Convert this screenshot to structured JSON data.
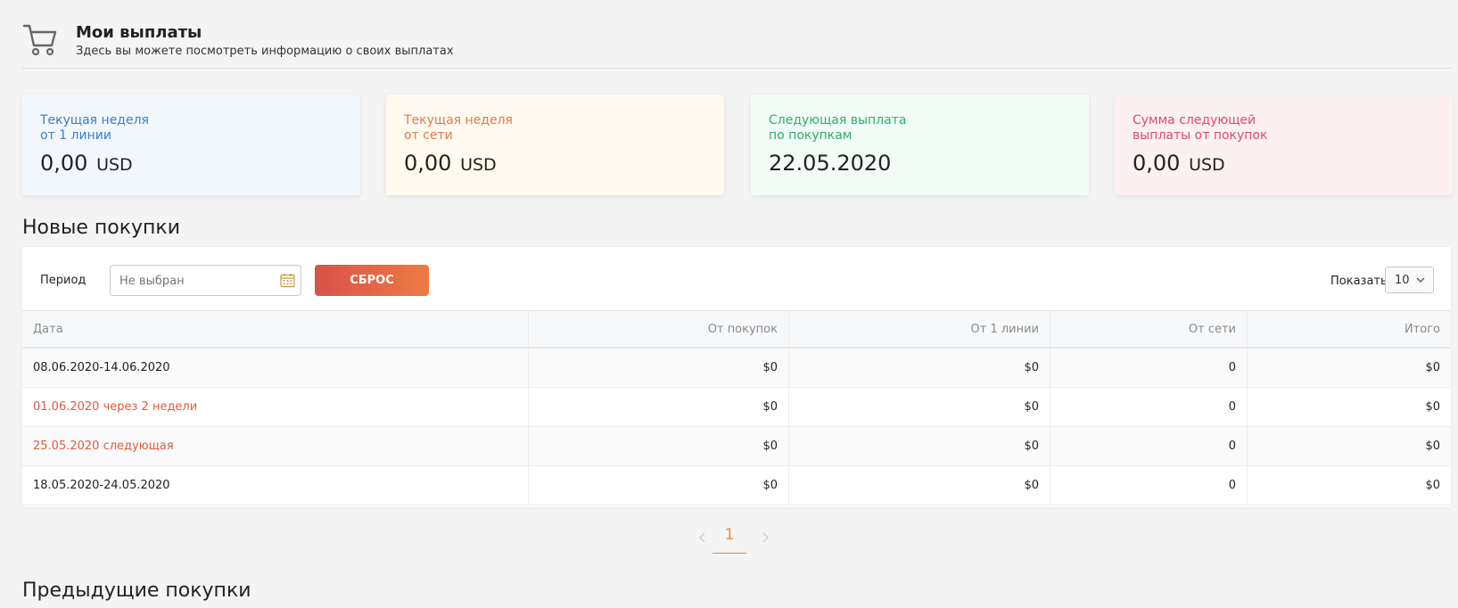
{
  "header": {
    "title": "Мои выплаты",
    "subtitle": "Здесь вы можете посмотреть информацию о своих выплатах",
    "icon": "cart-icon"
  },
  "cards": [
    {
      "label": "Текущая неделя\nот 1 линии",
      "value": "0,00",
      "unit": "USD",
      "color": "#3b7bc4"
    },
    {
      "label": "Текущая неделя\nот сети",
      "value": "0,00",
      "unit": "USD",
      "color": "#de7a4c"
    },
    {
      "label": "Следующая выплата\nпо покупкам",
      "value": "22.05.2020",
      "unit": "",
      "color": "#2fae6b"
    },
    {
      "label": "Сумма следующей\nвыплаты от покупок",
      "value": "0,00",
      "unit": "USD",
      "color": "#d84d6c"
    }
  ],
  "new_purchases": {
    "title": "Новые покупки",
    "filter": {
      "period_label": "Период",
      "period_placeholder": "Не выбран",
      "reset_label": "СБРОС",
      "show_label": "Показать",
      "show_value": "10"
    },
    "table": {
      "headers": [
        "Дата",
        "От покупок",
        "От 1 линии",
        "От сети",
        "Итого"
      ],
      "rows": [
        {
          "date": "08.06.2020-14.06.2020",
          "from_purchases": "$0",
          "from_line1": "$0",
          "from_network": "0",
          "total": "$0"
        },
        {
          "date": "01.06.2020 через 2 недели",
          "from_purchases": "$0",
          "from_line1": "$0",
          "from_network": "0",
          "total": "$0"
        },
        {
          "date": "25.05.2020 следующая",
          "from_purchases": "$0",
          "from_line1": "$0",
          "from_network": "0",
          "total": "$0"
        },
        {
          "date": "18.05.2020-24.05.2020",
          "from_purchases": "$0",
          "from_line1": "$0",
          "from_network": "0",
          "total": "$0"
        }
      ]
    },
    "pagination": {
      "current": "1"
    }
  },
  "previous_purchases": {
    "title": "Предыдущие покупки"
  },
  "colors": {
    "accent_orange": "#e98b3c",
    "highlight_row": "#e25a3e",
    "reset_gradient_start": "#d9524a",
    "reset_gradient_end": "#ee7a43"
  }
}
